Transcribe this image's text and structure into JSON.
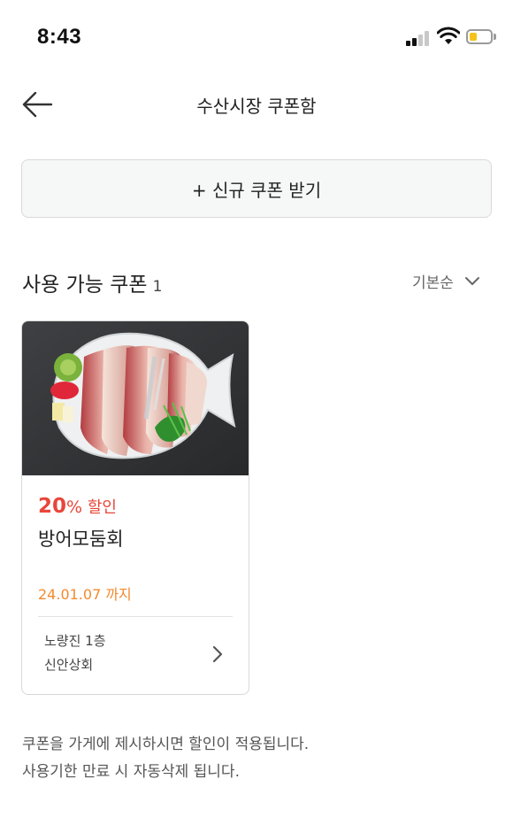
{
  "status_bar": {
    "time": "8:43",
    "battery_level": 0.35,
    "colors": {
      "battery": "#f5c21a"
    }
  },
  "header": {
    "title": "수산시장 쿠폰함",
    "back_icon": "arrow-left-icon"
  },
  "new_coupon_button": {
    "label": "+ 신규 쿠폰 받기"
  },
  "section": {
    "title": "사용 가능 쿠폰",
    "count": "1",
    "sort_label": "기본순",
    "sort_icon": "chevron-down-icon"
  },
  "coupons": [
    {
      "discount_value": "20",
      "discount_unit": "%",
      "discount_text": "할인",
      "name": "방어모둠회",
      "expiry": "24.01.07 까지",
      "store_location": "노량진 1층",
      "store_name": "신안상회",
      "image": "sashimi-platter-photo"
    }
  ],
  "notices": [
    "쿠폰을 가게에 제시하시면 할인이 적용됩니다.",
    "사용기한 만료 시 자동삭제 됩니다."
  ],
  "colors": {
    "discount": "#e8463a",
    "expiry": "#f28a2e",
    "button_bg": "#f6f7f7"
  }
}
